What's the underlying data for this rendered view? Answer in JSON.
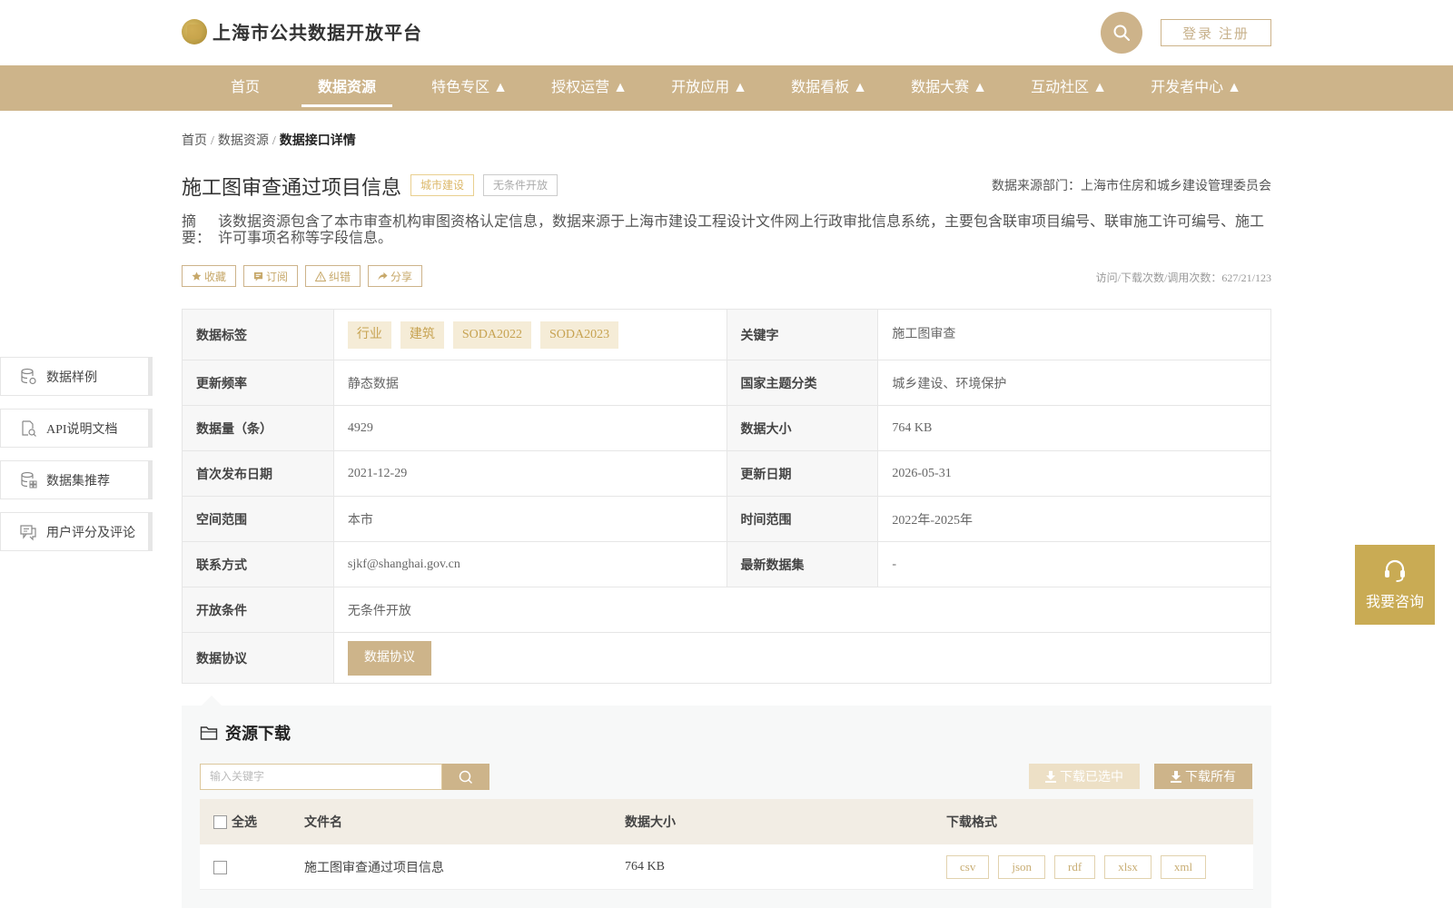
{
  "header": {
    "logo_text": "上海市公共数据开放平台",
    "login_label": "登录 注册"
  },
  "nav": {
    "items": [
      {
        "label": "首页"
      },
      {
        "label": "数据资源"
      },
      {
        "label": "特色专区 ▲"
      },
      {
        "label": "授权运营 ▲"
      },
      {
        "label": "开放应用 ▲"
      },
      {
        "label": "数据看板 ▲"
      },
      {
        "label": "数据大赛 ▲"
      },
      {
        "label": "互动社区 ▲"
      },
      {
        "label": "开发者中心 ▲"
      }
    ],
    "active_index": 1
  },
  "breadcrumb": {
    "home": "首页",
    "sep": "/",
    "section": "数据资源",
    "current": "数据接口详情"
  },
  "dataset": {
    "title": "施工图审查通过项目信息",
    "tag_city": "城市建设",
    "tag_open": "无条件开放",
    "source": "数据来源部门：上海市住房和城乡建设管理委员会",
    "summary_label": "摘　要：",
    "summary": "该数据资源包含了本市审查机构审图资格认定信息，数据来源于上海市建设工程设计文件网上行政审批信息系统，主要包含联审项目编号、联审施工许可编号、施工许可事项名称等字段信息。",
    "stats": "访问/下载次数/调用次数：627/21/123"
  },
  "actions": {
    "favorite": "收藏",
    "subscribe": "订阅",
    "correct": "纠错",
    "share": "分享"
  },
  "info": {
    "tags_label": "数据标签",
    "tags": [
      "行业",
      "建筑",
      "SODA2022",
      "SODA2023"
    ],
    "keyword_label": "关键字",
    "keyword": "施工图审查",
    "freq_label": "更新频率",
    "freq": "静态数据",
    "theme_label": "国家主题分类",
    "theme": "城乡建设、环境保护",
    "count_label": "数据量（条）",
    "count": "4929",
    "size_label": "数据大小",
    "size": "764 KB",
    "first_label": "首次发布日期",
    "first": "2021-12-29",
    "update_label": "更新日期",
    "update": "2026-05-31",
    "space_label": "空间范围",
    "space": "本市",
    "time_label": "时间范围",
    "time": "2022年-2025年",
    "contact_label": "联系方式",
    "contact": "sjkf@shanghai.gov.cn",
    "latest_label": "最新数据集",
    "latest": "-",
    "cond_label": "开放条件",
    "cond": "无条件开放",
    "proto_label": "数据协议",
    "proto_btn": "数据协议"
  },
  "side": {
    "items": [
      {
        "label": "数据样例"
      },
      {
        "label": "API说明文档"
      },
      {
        "label": "数据集推荐"
      },
      {
        "label": "用户评分及评论"
      }
    ]
  },
  "consult": {
    "label": "我要咨询"
  },
  "resources": {
    "title": "资源下载",
    "search_placeholder": "输入关键字",
    "download_selected": "下载已选中",
    "download_all": "下载所有",
    "columns": {
      "select_all": "全选",
      "name": "文件名",
      "size": "数据大小",
      "format": "下载格式"
    },
    "rows": [
      {
        "name": "施工图审查通过项目信息",
        "size": "764 KB",
        "formats": [
          "csv",
          "json",
          "rdf",
          "xlsx",
          "xml"
        ]
      }
    ]
  },
  "colors": {
    "accent": "#cdb48a",
    "accent_text": "#c7a352",
    "consult_bg": "#c9ab54"
  }
}
